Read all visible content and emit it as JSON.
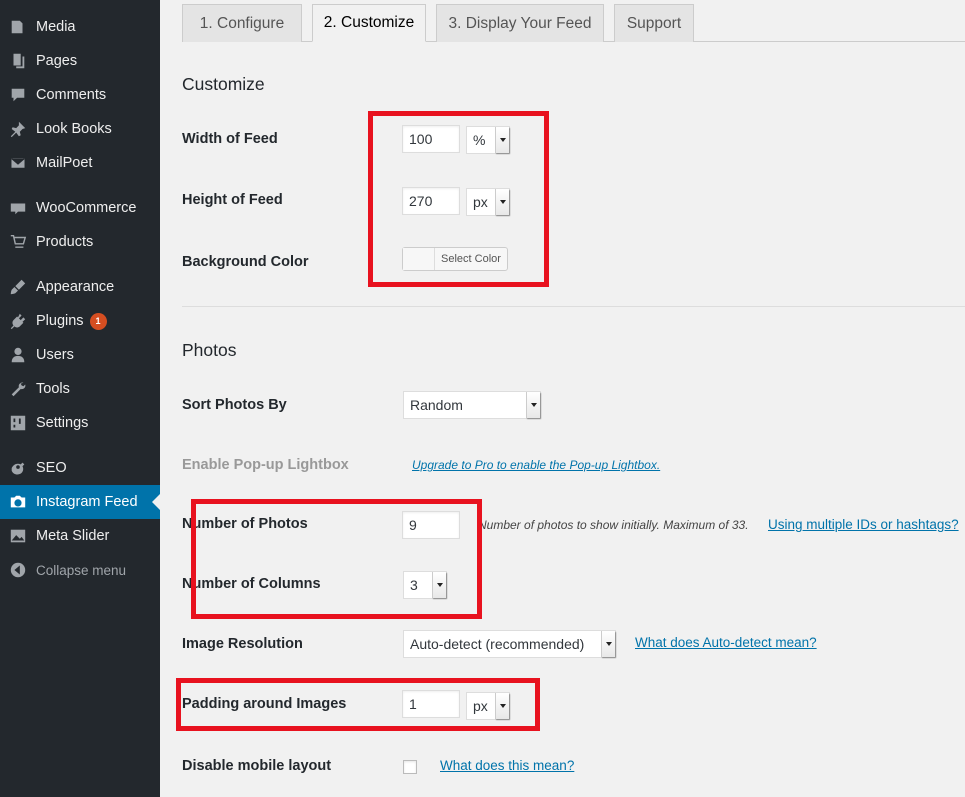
{
  "sidebar": {
    "items": [
      {
        "label": "Media",
        "icon": "media-icon"
      },
      {
        "label": "Pages",
        "icon": "pages-icon"
      },
      {
        "label": "Comments",
        "icon": "comments-icon"
      },
      {
        "label": "Look Books",
        "icon": "pin-icon"
      },
      {
        "label": "MailPoet",
        "icon": "mail-icon"
      },
      {
        "label": "WooCommerce",
        "icon": "woo-icon"
      },
      {
        "label": "Products",
        "icon": "cart-icon"
      },
      {
        "label": "Appearance",
        "icon": "brush-icon"
      },
      {
        "label": "Plugins",
        "icon": "plug-icon",
        "badge": "1"
      },
      {
        "label": "Users",
        "icon": "user-icon"
      },
      {
        "label": "Tools",
        "icon": "wrench-icon"
      },
      {
        "label": "Settings",
        "icon": "settings-icon"
      },
      {
        "label": "SEO",
        "icon": "seo-icon"
      },
      {
        "label": "Instagram Feed",
        "icon": "camera-icon",
        "active": true
      },
      {
        "label": "Meta Slider",
        "icon": "image-icon"
      }
    ],
    "collapse_label": "Collapse menu",
    "accent": "#0073aa"
  },
  "tabs": [
    {
      "label": "1. Configure"
    },
    {
      "label": "2. Customize",
      "active": true
    },
    {
      "label": "3. Display Your Feed"
    },
    {
      "label": "Support"
    }
  ],
  "customize": {
    "heading": "Customize",
    "width": {
      "label": "Width of Feed",
      "value": "100",
      "unit": "%"
    },
    "height": {
      "label": "Height of Feed",
      "value": "270",
      "unit": "px"
    },
    "background": {
      "label": "Background Color",
      "button": "Select Color"
    }
  },
  "photos": {
    "heading": "Photos",
    "sort": {
      "label": "Sort Photos By",
      "value": "Random"
    },
    "lightbox": {
      "label": "Enable Pop-up Lightbox",
      "link": "Upgrade to Pro to enable the Pop-up Lightbox."
    },
    "num_photos": {
      "label": "Number of Photos",
      "value": "9",
      "note": "Number of photos to show initially. Maximum of 33.",
      "link": "Using multiple IDs or hashtags?"
    },
    "num_columns": {
      "label": "Number of Columns",
      "value": "3"
    },
    "resolution": {
      "label": "Image Resolution",
      "value": "Auto-detect (recommended)",
      "link": "What does Auto-detect mean?"
    },
    "padding": {
      "label": "Padding around Images",
      "value": "1",
      "unit": "px"
    },
    "mobile": {
      "label": "Disable mobile layout",
      "link": "What does this mean?"
    }
  },
  "highlight_color": "#e8121f"
}
